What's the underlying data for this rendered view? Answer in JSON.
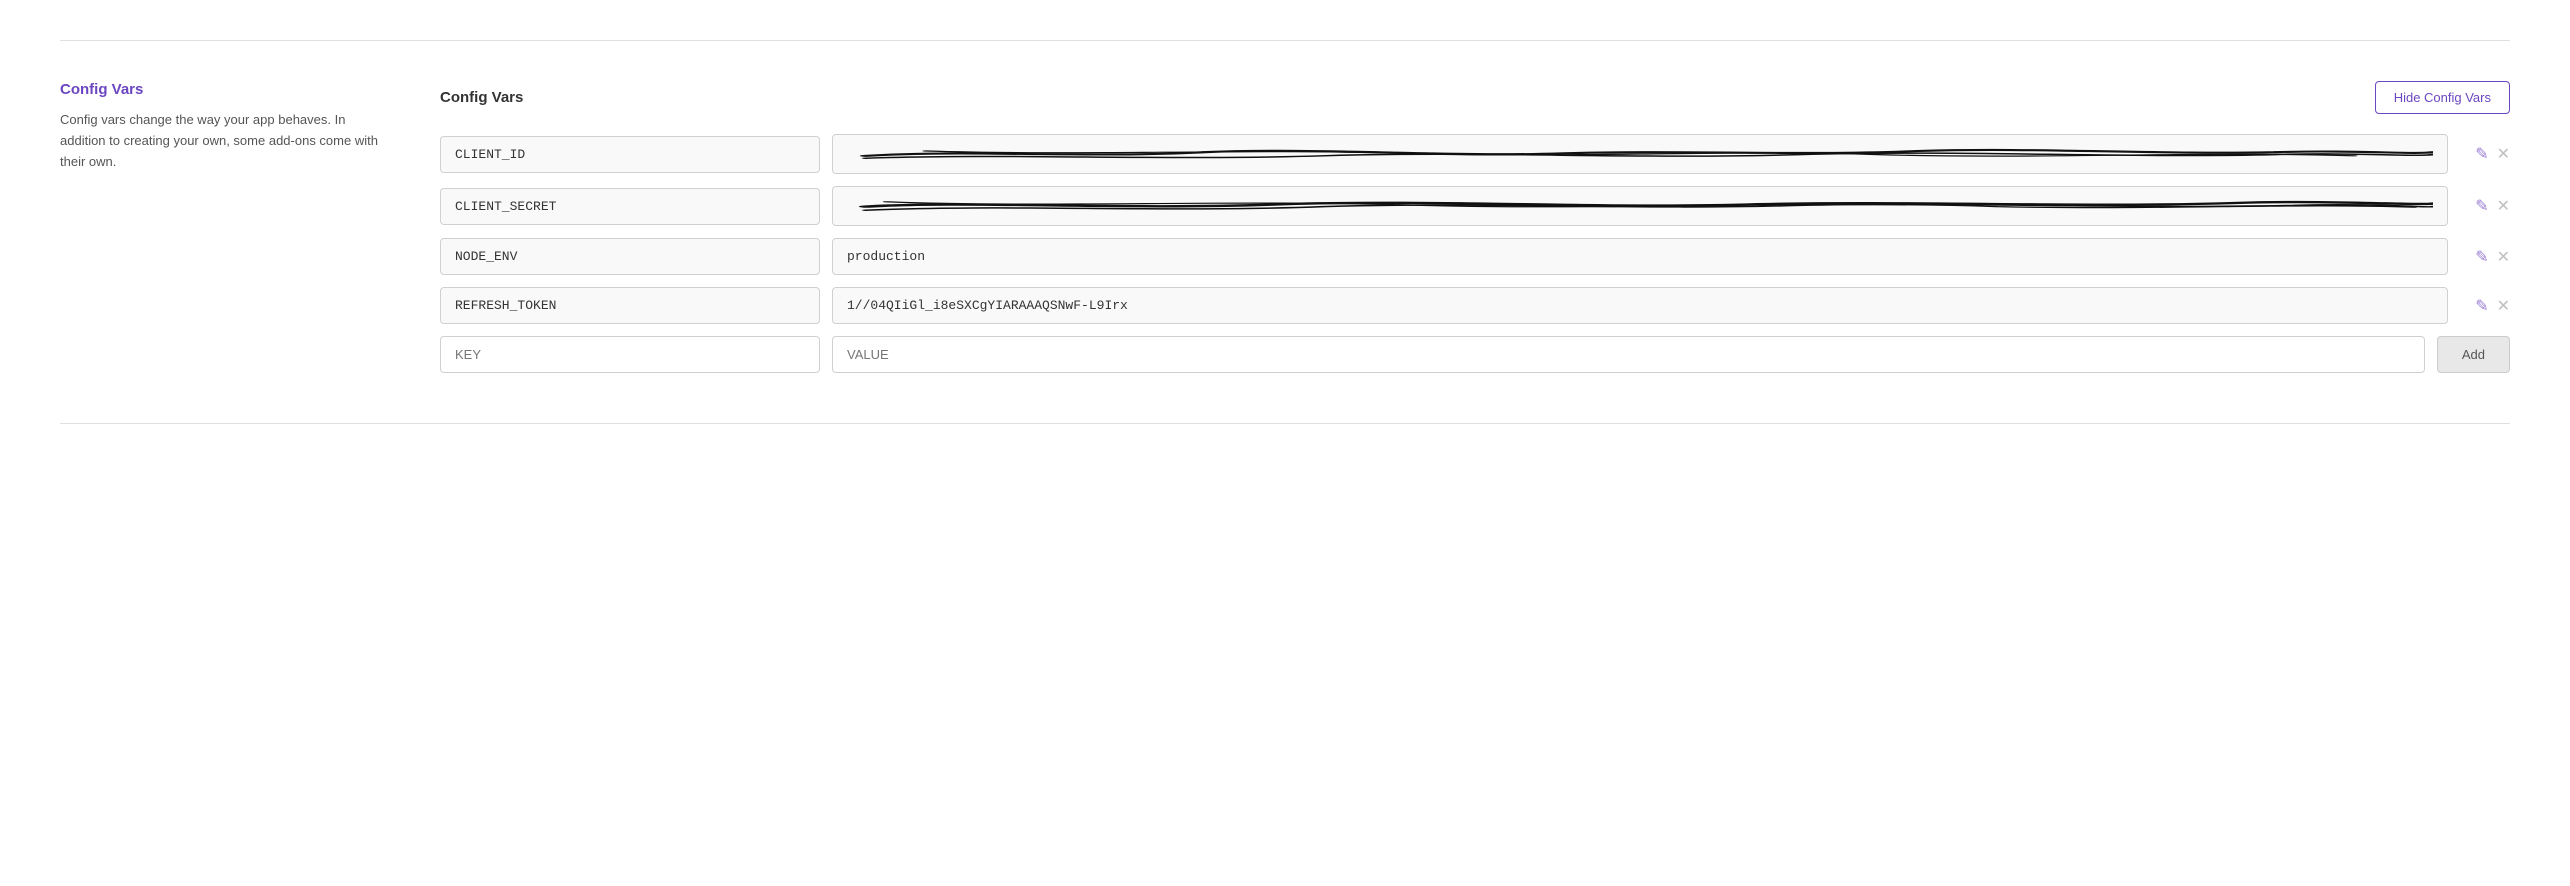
{
  "section": {
    "left": {
      "title": "Config Vars",
      "description": "Config vars change the way your app behaves. In addition to creating your own, some add-ons come with their own."
    },
    "right": {
      "title": "Config Vars",
      "hide_button_label": "Hide Config Vars"
    }
  },
  "config_vars": [
    {
      "key": "CLIENT_ID",
      "value": "",
      "redacted": true
    },
    {
      "key": "CLIENT_SECRET",
      "value": "",
      "redacted": true
    },
    {
      "key": "NODE_ENV",
      "value": "production",
      "redacted": false
    },
    {
      "key": "REFRESH_TOKEN",
      "value": "1//04QIiGl_i8eSXCgYIARAAAQSNwF-L9Irx",
      "redacted": false
    }
  ],
  "new_row": {
    "key_placeholder": "KEY",
    "value_placeholder": "VALUE",
    "add_label": "Add"
  },
  "icons": {
    "edit": "✎",
    "delete": "✕"
  }
}
